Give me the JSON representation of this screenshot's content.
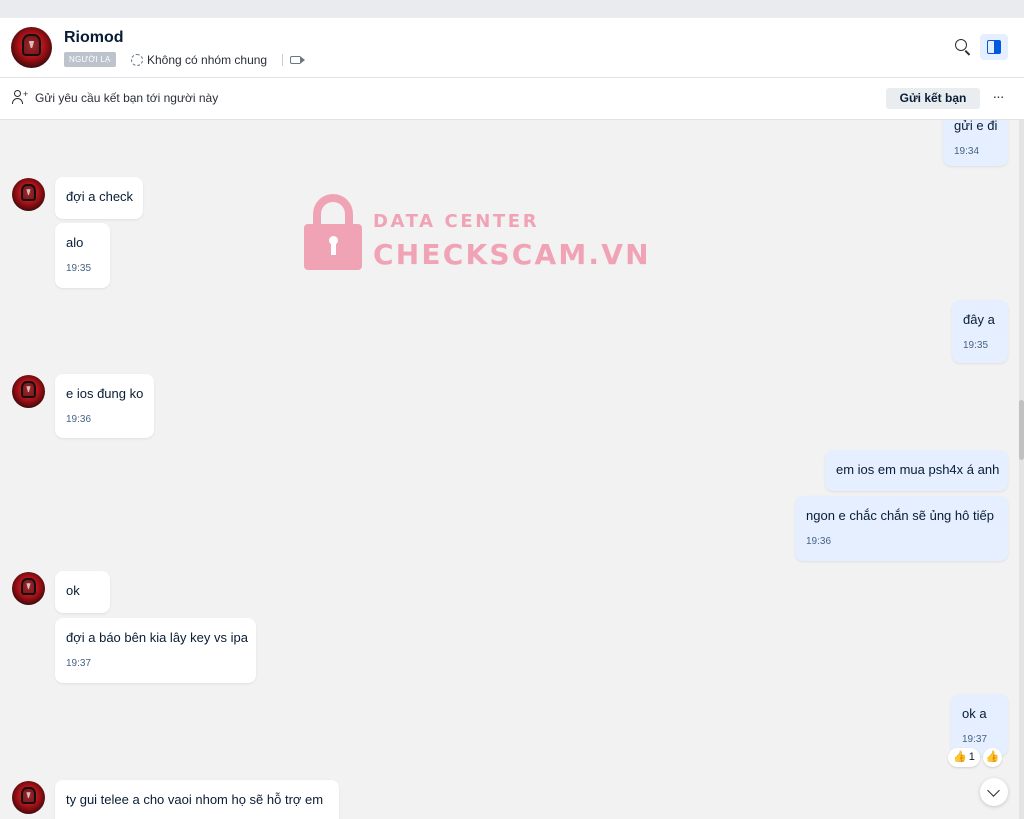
{
  "header": {
    "name": "Riomod",
    "badge": "NGƯỜI LẠ",
    "common_groups": "Không có nhóm chung"
  },
  "friend_bar": {
    "text": "Gửi yêu cầu kết bạn tới người này",
    "button": "Gửi kết bạn",
    "more": "···"
  },
  "watermark": {
    "line1": "DATA CENTER",
    "line2": "CHECKSCAM.VN"
  },
  "messages": [
    {
      "from": "me",
      "text": "gửi e đi",
      "time": "19:34"
    },
    {
      "from": "them",
      "text": "đợi a check",
      "time": ""
    },
    {
      "from": "them",
      "text": "alo",
      "time": "19:35"
    },
    {
      "from": "me",
      "text": "đây a",
      "time": "19:35"
    },
    {
      "from": "them",
      "text": "e ios đung ko",
      "time": "19:36"
    },
    {
      "from": "me",
      "text": "em ios em mua psh4x á anh",
      "time": ""
    },
    {
      "from": "me",
      "text": "ngon e chắc chắn sẽ ủng hô tiếp",
      "time": "19:36"
    },
    {
      "from": "them",
      "text": "ok",
      "time": ""
    },
    {
      "from": "them",
      "text": "đợi a báo bên kia lây key vs ipa",
      "time": "19:37"
    },
    {
      "from": "me",
      "text": "ok a",
      "time": "19:37"
    },
    {
      "from": "them",
      "text": "ty gui telee a cho vaoi nhom họ sẽ hỗ trợ em",
      "time": ""
    }
  ],
  "reaction": {
    "emoji": "👍",
    "count": "1",
    "add_icon": "thumbs-up-outline"
  },
  "icons": {
    "search": "search-icon",
    "panel": "panel-toggle-icon",
    "scroll": "chevron-down-icon"
  },
  "colors": {
    "accent": "#005ae0",
    "my_bubble": "#e5efff",
    "their_bubble": "#ffffff",
    "watermark": "#f1a3b6"
  }
}
